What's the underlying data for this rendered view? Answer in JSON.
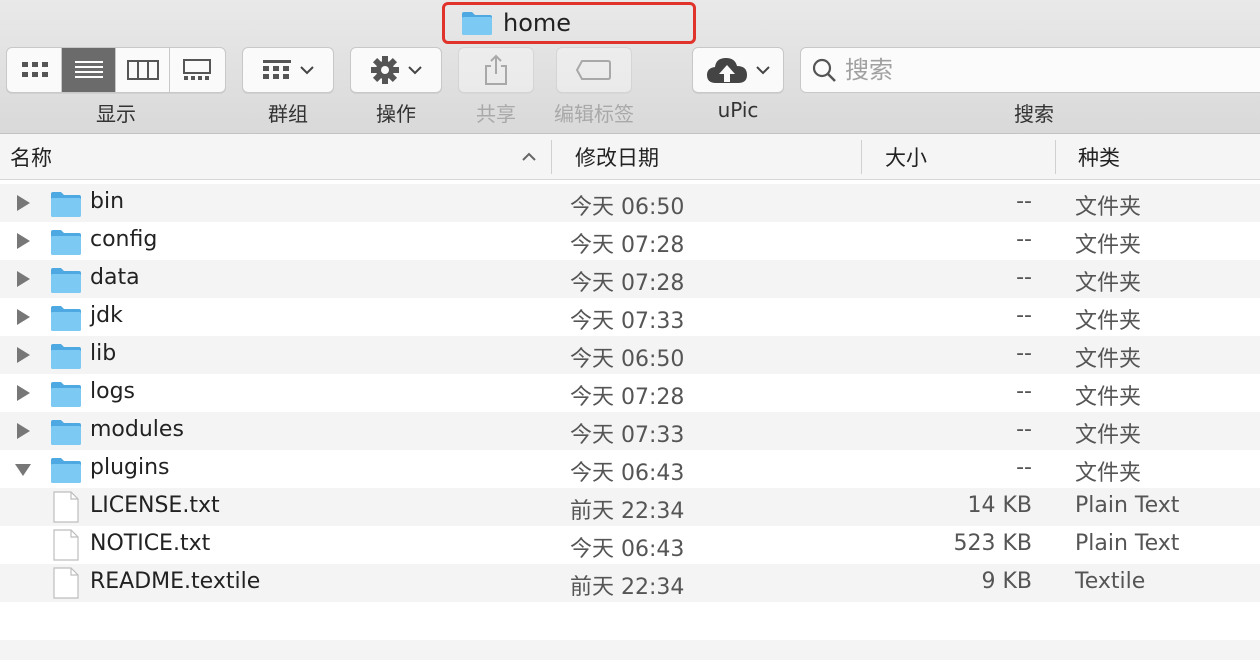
{
  "window": {
    "title": "home",
    "title_icon": "folder-icon",
    "title_highlight_color": "#e0332b"
  },
  "toolbar": {
    "view_label": "显示",
    "group_label": "群组",
    "action_label": "操作",
    "share_label": "共享",
    "tags_label": "编辑标签",
    "upic_label": "uPic",
    "search_label": "搜索",
    "search_placeholder": "搜索",
    "active_view": "list"
  },
  "columns": {
    "name": "名称",
    "date": "修改日期",
    "size": "大小",
    "kind": "种类",
    "sort_indicator": "chevron-up"
  },
  "rows": [
    {
      "name": "bin",
      "date": "今天 06:50",
      "size": "--",
      "kind": "文件夹",
      "type": "folder",
      "expanded": false
    },
    {
      "name": "config",
      "date": "今天 07:28",
      "size": "--",
      "kind": "文件夹",
      "type": "folder",
      "expanded": false
    },
    {
      "name": "data",
      "date": "今天 07:28",
      "size": "--",
      "kind": "文件夹",
      "type": "folder",
      "expanded": false
    },
    {
      "name": "jdk",
      "date": "今天 07:33",
      "size": "--",
      "kind": "文件夹",
      "type": "folder",
      "expanded": false
    },
    {
      "name": "lib",
      "date": "今天 06:50",
      "size": "--",
      "kind": "文件夹",
      "type": "folder",
      "expanded": false
    },
    {
      "name": "logs",
      "date": "今天 07:28",
      "size": "--",
      "kind": "文件夹",
      "type": "folder",
      "expanded": false
    },
    {
      "name": "modules",
      "date": "今天 07:33",
      "size": "--",
      "kind": "文件夹",
      "type": "folder",
      "expanded": false
    },
    {
      "name": "plugins",
      "date": "今天 06:43",
      "size": "--",
      "kind": "文件夹",
      "type": "folder",
      "expanded": true
    },
    {
      "name": "LICENSE.txt",
      "date": "前天 22:34",
      "size": "14 KB",
      "kind": "Plain Text",
      "type": "file"
    },
    {
      "name": "NOTICE.txt",
      "date": "今天 06:43",
      "size": "523 KB",
      "kind": "Plain Text",
      "type": "file"
    },
    {
      "name": "README.textile",
      "date": "前天 22:34",
      "size": "9 KB",
      "kind": "Textile",
      "type": "file"
    }
  ],
  "colors": {
    "folder": "#6cc0f0",
    "folder_tab": "#4ea9e2",
    "row_alt": "#f4f4f4",
    "selected_view": "#6b6b6b"
  }
}
